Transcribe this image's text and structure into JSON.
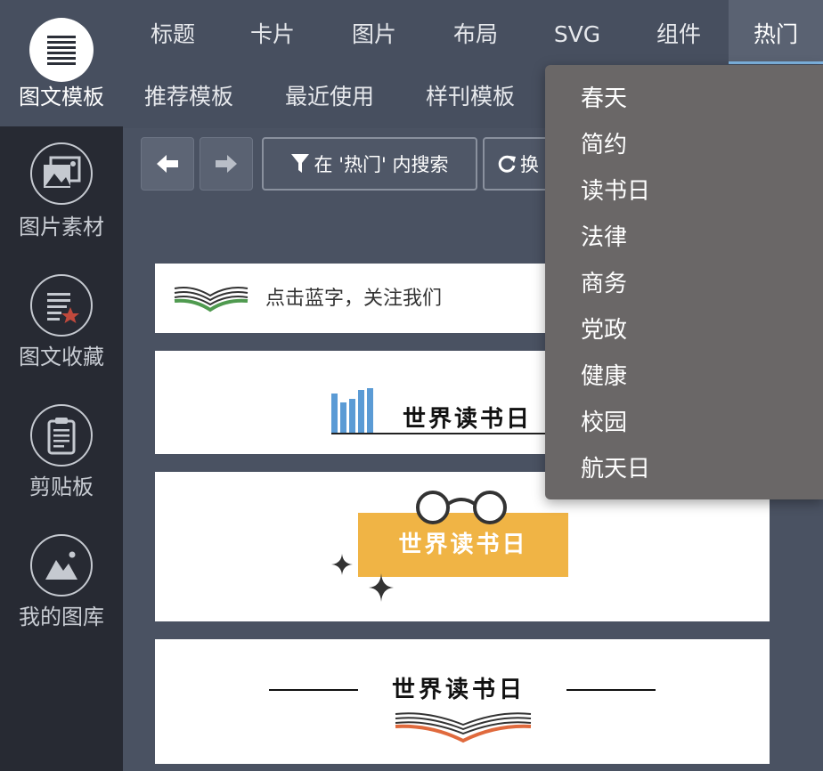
{
  "sidebar": {
    "items": [
      {
        "label": "图文模板",
        "icon": "template-list-icon",
        "active": true
      },
      {
        "label": "图片素材",
        "icon": "image-gallery-icon"
      },
      {
        "label": "图文收藏",
        "icon": "favorites-icon"
      },
      {
        "label": "剪贴板",
        "icon": "clipboard-icon"
      },
      {
        "label": "我的图库",
        "icon": "my-gallery-icon"
      }
    ]
  },
  "tabs": [
    "标题",
    "卡片",
    "图片",
    "布局",
    "SVG",
    "组件",
    "热门"
  ],
  "active_tab": "热门",
  "subtabs": [
    "推荐模板",
    "最近使用",
    "样刊模板"
  ],
  "toolbar": {
    "back_icon": "arrow-left-icon",
    "forward_icon": "arrow-right-icon",
    "search_label": "在 '热门' 内搜索",
    "refresh_label": "换"
  },
  "cards": {
    "follow_text": "点击蓝字，关注我们",
    "title1": "世界读书日",
    "title2": "世界读书日",
    "title3": "世界读书日"
  },
  "dropdown": [
    "春天",
    "简约",
    "读书日",
    "法律",
    "商务",
    "党政",
    "健康",
    "校园",
    "航天日"
  ],
  "colors": {
    "accent_blue": "#7fb6e4",
    "book_green": "#4f9a4f",
    "bars_blue": "#5b9bd5",
    "banner_yellow": "#f0b445",
    "book_orange": "#e06a3d",
    "star_red": "#c0493c"
  }
}
